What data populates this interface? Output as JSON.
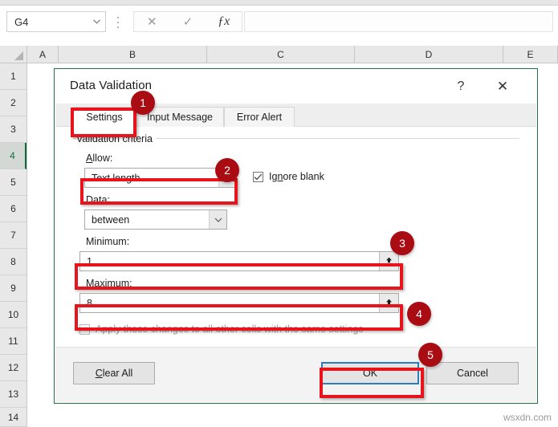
{
  "app": {
    "name_box": {
      "value": "G4",
      "dropdown_icon": "chevron-down-icon"
    },
    "formula_buttons": {
      "cancel": "✕",
      "confirm": "✓",
      "function": "ƒx"
    },
    "formula_value": ""
  },
  "grid": {
    "columns": [
      "A",
      "B",
      "C",
      "D",
      "E"
    ],
    "rows": [
      "1",
      "2",
      "3",
      "4",
      "5",
      "6",
      "7",
      "8",
      "9",
      "10",
      "11",
      "12",
      "13",
      "14"
    ],
    "active_row": "4"
  },
  "dialog": {
    "title": "Data Validation",
    "help_label": "?",
    "close_label": "✕",
    "tabs": [
      {
        "label": "Settings",
        "active": true
      },
      {
        "label": "Input Message",
        "active": false
      },
      {
        "label": "Error Alert",
        "active": false
      }
    ],
    "group_title": "Validation criteria",
    "allow": {
      "label_prefix": "",
      "label_underlined": "A",
      "label_suffix": "llow:",
      "value": "Text length"
    },
    "data": {
      "label_underlined": "D",
      "label_suffix": "ata:",
      "value": "between"
    },
    "minimum": {
      "label": "Minimum:",
      "value": "1"
    },
    "maximum": {
      "label": "Maximum:",
      "value": "8"
    },
    "ignore_blank": {
      "label_prefix": "Ig",
      "label_underlined": "n",
      "label_suffix": "ore blank",
      "checked": true
    },
    "apply_changes": {
      "label": "Apply these changes to all other cells with the same settings",
      "checked": false,
      "disabled": true
    },
    "buttons": {
      "clear_all_prefix": "",
      "clear_all_underlined": "C",
      "clear_all_suffix": "lear All",
      "ok": "OK",
      "cancel": "Cancel"
    }
  },
  "annotations": {
    "badges": [
      "1",
      "2",
      "3",
      "4",
      "5"
    ],
    "highlight_color": "#e8141b",
    "badge_color": "#a90c12",
    "focus_color": "#2c7dbd",
    "selection_color": "#217346"
  },
  "watermark": "wsxdn.com"
}
